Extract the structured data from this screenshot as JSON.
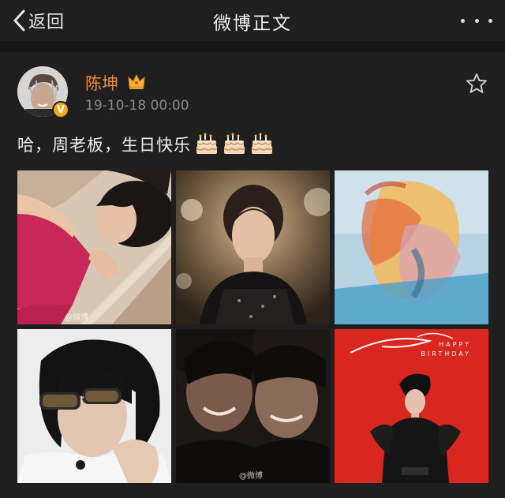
{
  "nav": {
    "back_label": "返回",
    "title": "微博正文"
  },
  "post": {
    "author": "陈坤",
    "verified_badge": "V",
    "timestamp": "19-10-18 00:00",
    "text": "哈，周老板，生日快乐",
    "emoji_icons": [
      "cake-icon",
      "cake-icon",
      "cake-icon"
    ]
  },
  "photos": [
    {
      "name": "photo-1",
      "watermark": "@微博"
    },
    {
      "name": "photo-2",
      "watermark": ""
    },
    {
      "name": "photo-3",
      "watermark": ""
    },
    {
      "name": "photo-4",
      "watermark": ""
    },
    {
      "name": "photo-5",
      "watermark": "@微博"
    },
    {
      "name": "photo-6",
      "caption_lines": [
        "HAPPY",
        "BIRTHDAY"
      ]
    }
  ],
  "colors": {
    "background": "#1f1f1f",
    "username": "#f28a2e",
    "timestamp": "#8c8c8c",
    "badge": "#f5a623"
  }
}
